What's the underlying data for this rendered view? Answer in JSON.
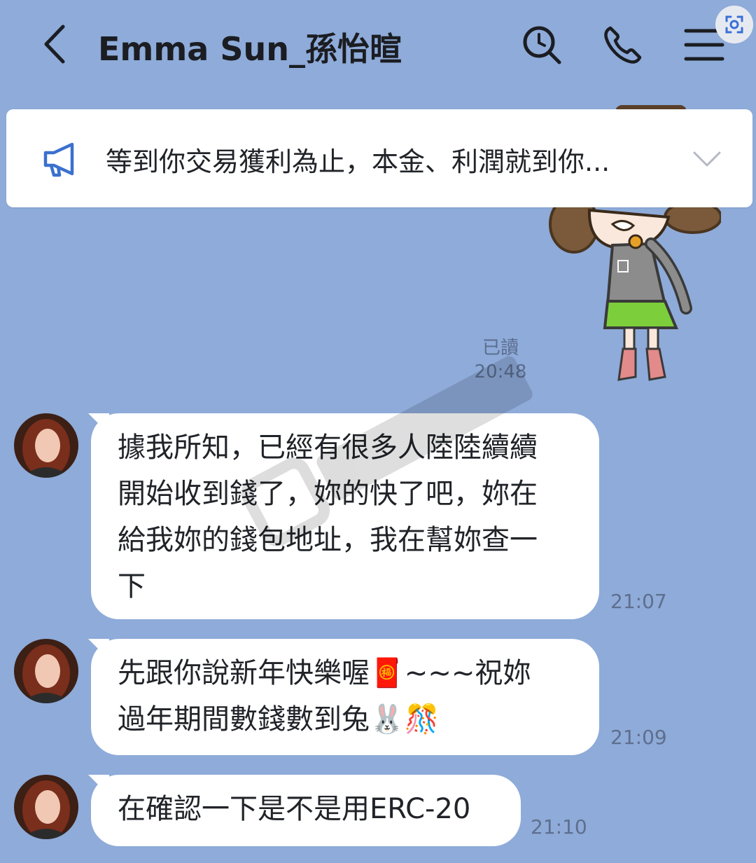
{
  "header": {
    "title": "Emma Sun_孫怡暄",
    "back_icon": "chevron-left-icon",
    "search_icon": "search-icon",
    "call_icon": "phone-icon",
    "menu_icon": "menu-icon",
    "scan_icon": "scan-icon"
  },
  "announcement": {
    "icon": "megaphone-icon",
    "text": "等到你交易獲利為止，本金、利潤就到你...",
    "expand_icon": "chevron-down-icon"
  },
  "sticker": {
    "read_label": "已讀",
    "time": "20:48"
  },
  "messages": [
    {
      "lines": [
        "據我所知，已經有很多人陸陸續續",
        "開始收到錢了，妳的快了吧，妳在",
        "給我妳的錢包地址，我在幫妳查一",
        "下"
      ],
      "time": "21:07"
    },
    {
      "lines": [
        "先跟你說新年快樂喔🧧~~~祝妳",
        "過年期間數錢數到兔🐰🎊"
      ],
      "time": "21:09"
    },
    {
      "lines": [
        "在確認一下是不是用ERC-20"
      ],
      "time": "21:10"
    }
  ],
  "colors": {
    "background": "#8eabd9",
    "bubble": "#ffffff",
    "text": "#202328",
    "timestamp": "#5e6f8d"
  }
}
